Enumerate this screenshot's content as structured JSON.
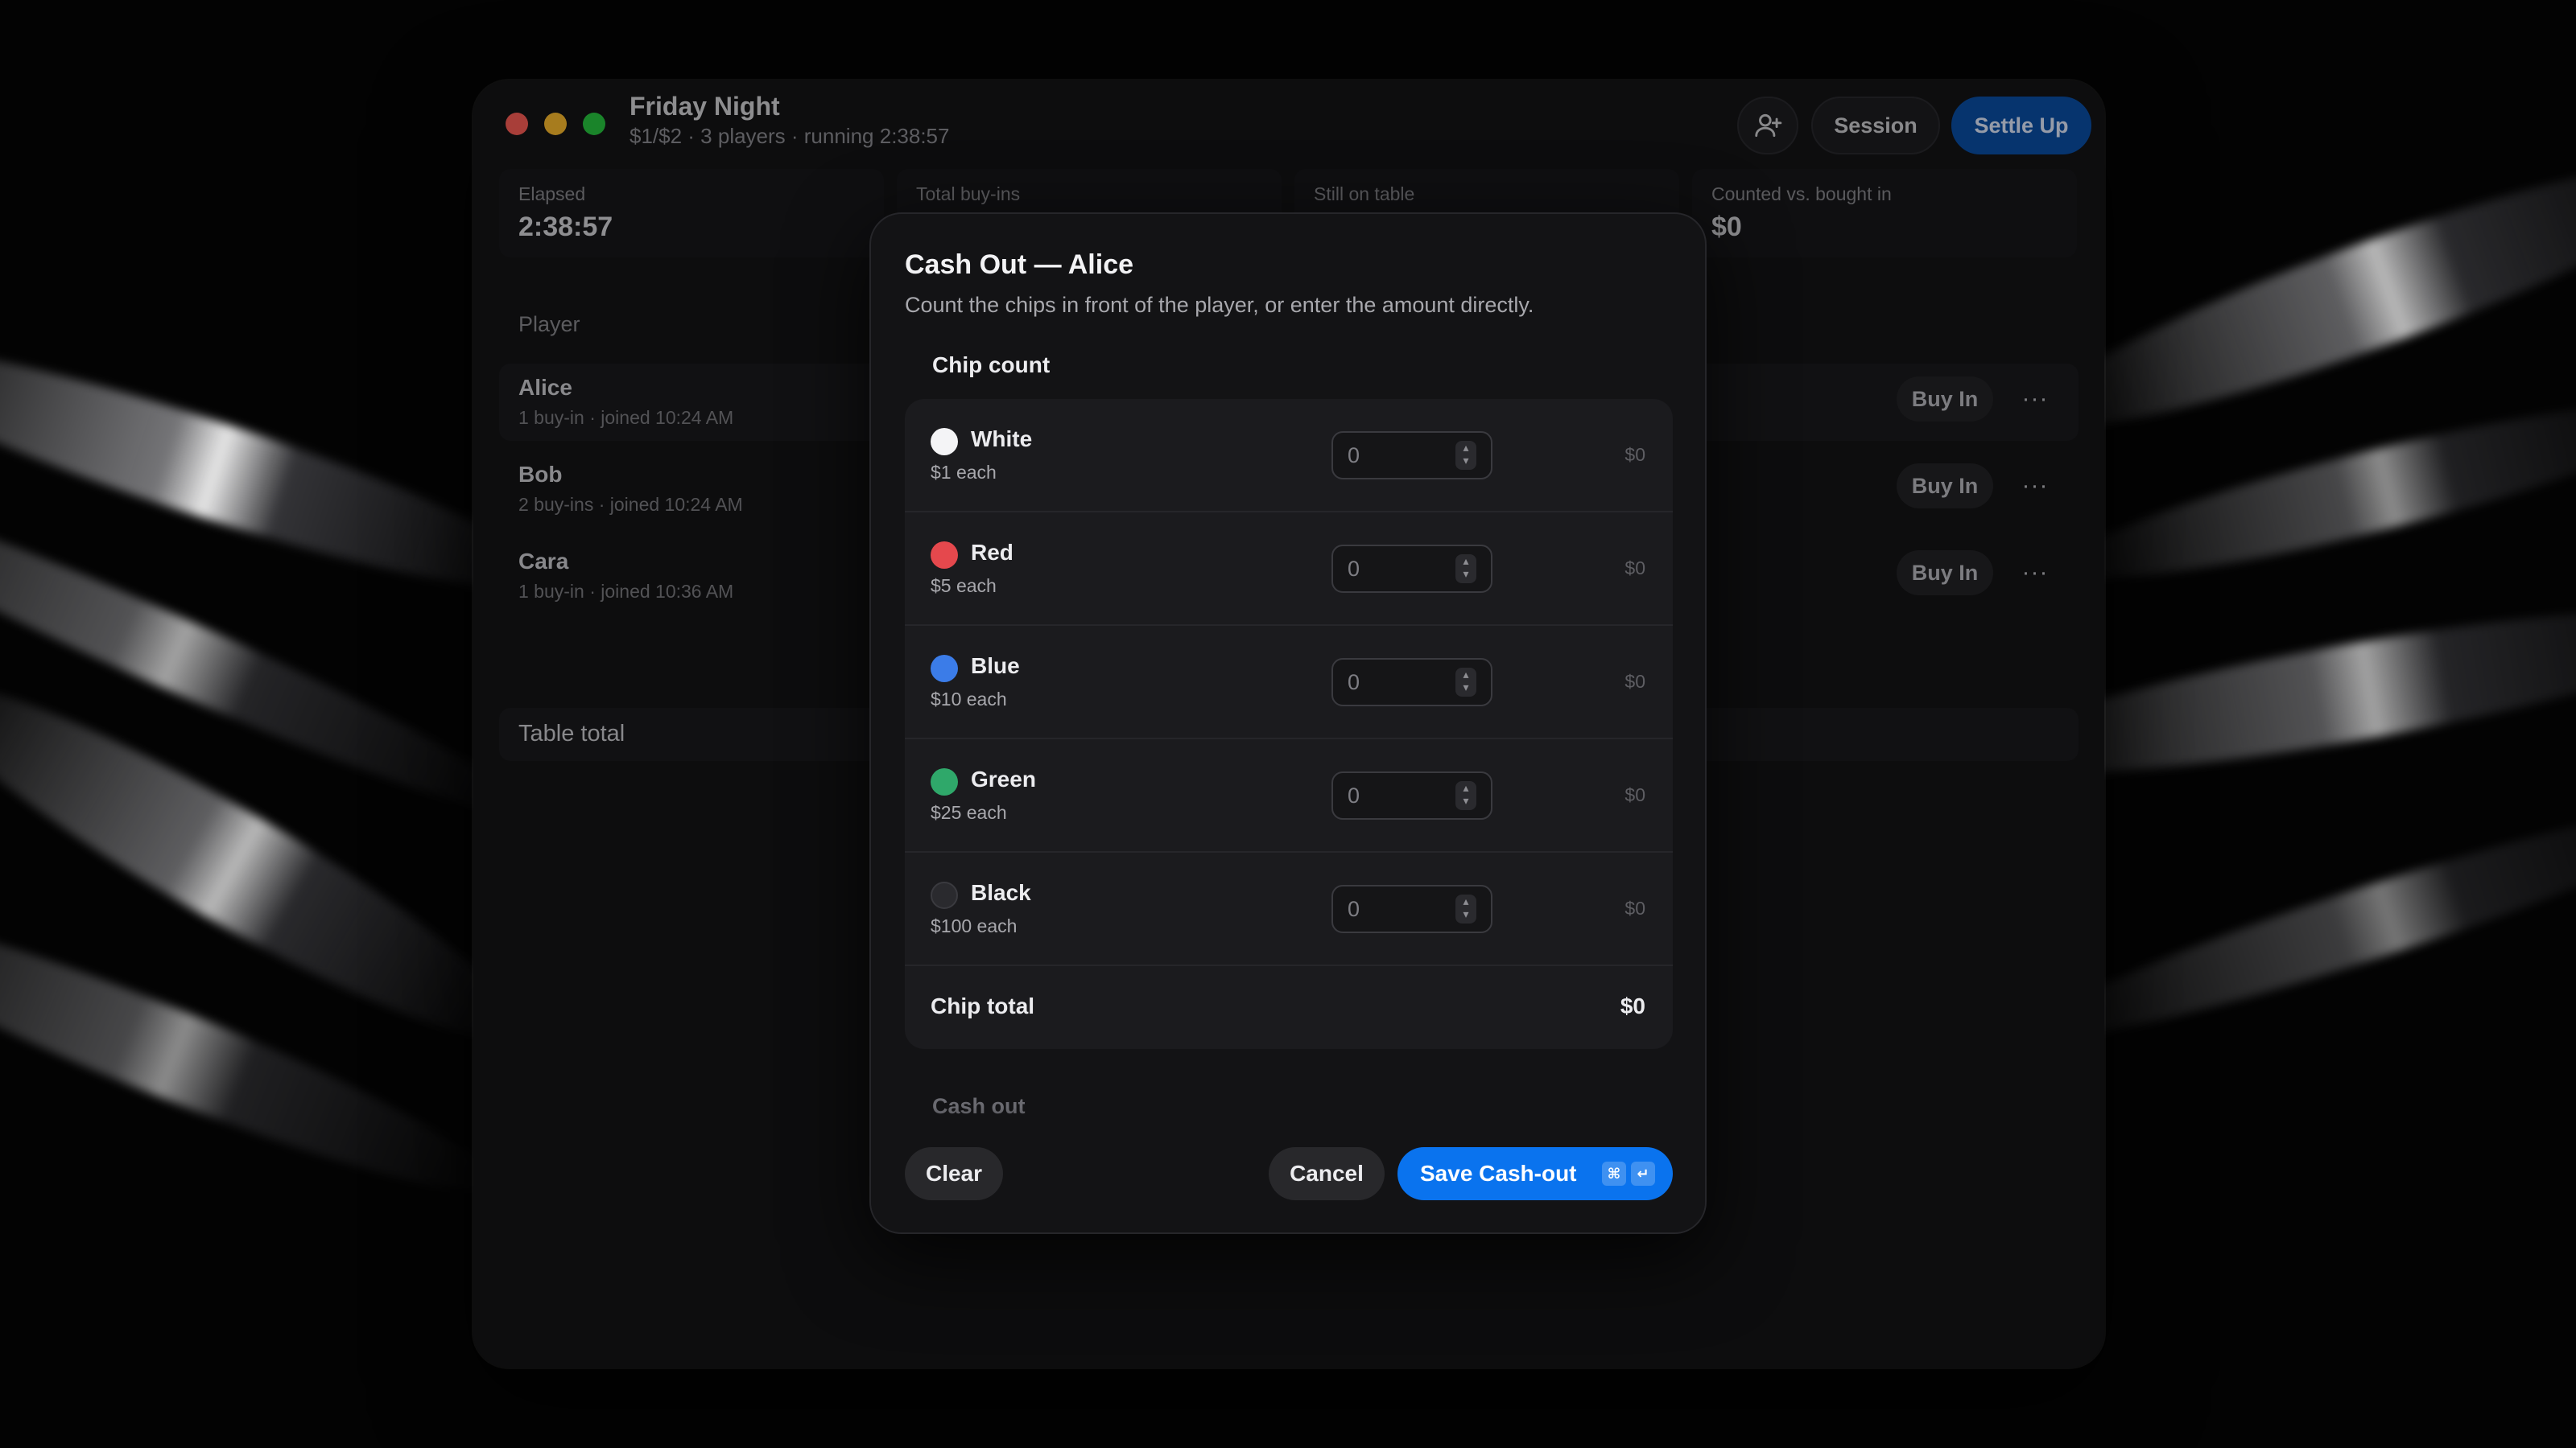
{
  "window": {
    "title": "Friday Night",
    "subtitle": "$1/$2 · 3 players · running 2:38:57"
  },
  "toolbar": {
    "add_player_icon": "person-add-icon",
    "session_label": "Session",
    "settle_label": "Settle Up"
  },
  "stats": [
    {
      "label": "Elapsed",
      "value": "2:38:57"
    },
    {
      "label": "Total buy-ins",
      "value": ""
    },
    {
      "label": "Still on table",
      "value": ""
    },
    {
      "label": "Counted vs. bought in",
      "value": "$0"
    }
  ],
  "players": {
    "header": "Player",
    "buyin_label": "Buy In",
    "more_label": "···",
    "rows": [
      {
        "name": "Alice",
        "meta": "1 buy-in · joined 10:24 AM"
      },
      {
        "name": "Bob",
        "meta": "2 buy-ins · joined 10:24 AM"
      },
      {
        "name": "Cara",
        "meta": "1 buy-in · joined 10:36 AM"
      }
    ],
    "table_total_label": "Table total"
  },
  "modal": {
    "title": "Cash Out — Alice",
    "description": "Count the chips in front of the player, or enter the amount directly.",
    "chip_count_label": "Chip count",
    "chips": [
      {
        "name": "White",
        "each": "$1 each",
        "value": "0",
        "placeholder": "0",
        "subtotal": "$0",
        "color": "#f4f4f6"
      },
      {
        "name": "Red",
        "each": "$5 each",
        "value": "0",
        "placeholder": "0",
        "subtotal": "$0",
        "color": "#e5484d"
      },
      {
        "name": "Blue",
        "each": "$10 each",
        "value": "0",
        "placeholder": "0",
        "subtotal": "$0",
        "color": "#3b7ce8"
      },
      {
        "name": "Green",
        "each": "$25 each",
        "value": "0",
        "placeholder": "0",
        "subtotal": "$0",
        "color": "#2fa86a"
      },
      {
        "name": "Black",
        "each": "$100 each",
        "value": "0",
        "placeholder": "0",
        "subtotal": "$0",
        "color": "#2a2a2e"
      }
    ],
    "chip_total_label": "Chip total",
    "chip_total_value": "$0",
    "cash_out_label": "Cash out",
    "clear_label": "Clear",
    "cancel_label": "Cancel",
    "save_label": "Save Cash-out",
    "shortcut_cmd": "⌘",
    "shortcut_return": "↵"
  },
  "colors": {
    "accent": "#0a73ee",
    "settle_button": "#0a4fa8"
  }
}
